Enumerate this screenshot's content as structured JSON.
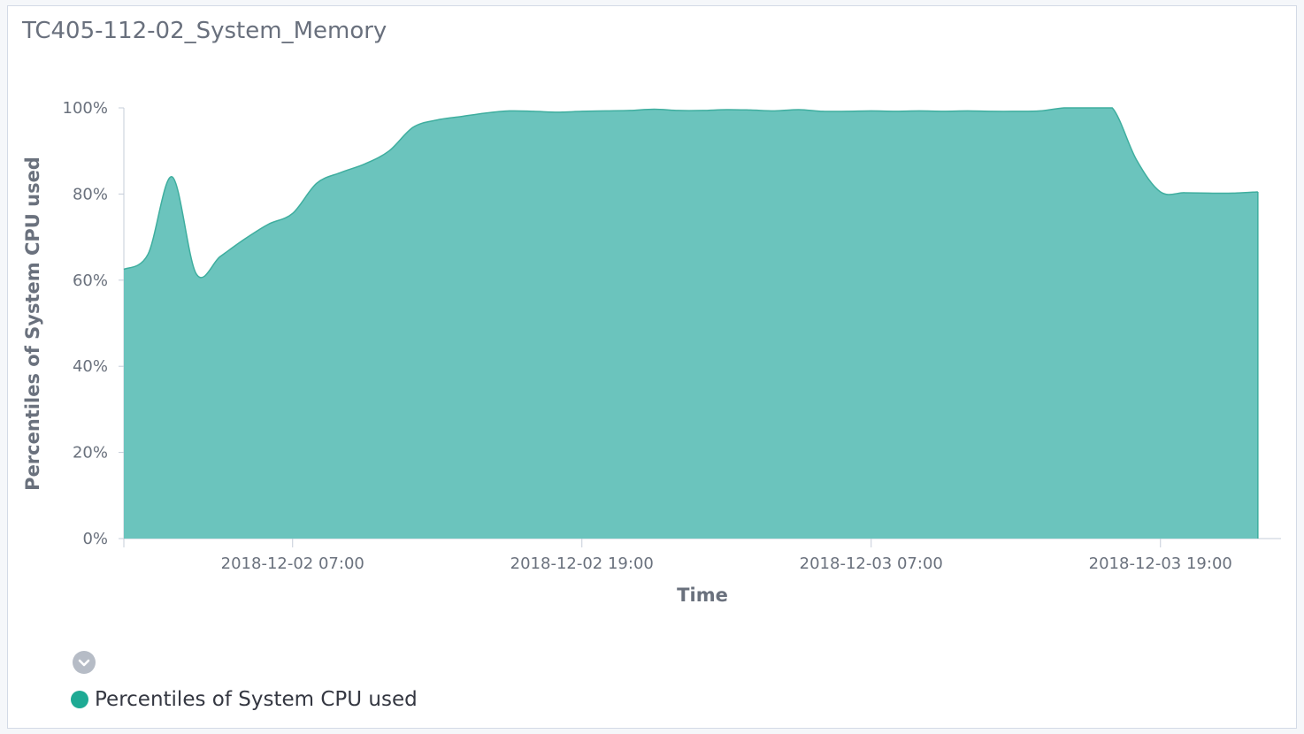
{
  "panel": {
    "title": "TC405-112-02_System_Memory"
  },
  "colors": {
    "series": "#6bc4bd",
    "series_line": "#3fae9f",
    "legend_dot": "#1eaa94",
    "axis": "#c5ccd8"
  },
  "legend": {
    "toggle_icon": "chevron-down-icon",
    "items": [
      {
        "label": "Percentiles of System CPU used"
      }
    ]
  },
  "chart_data": {
    "type": "area",
    "xlabel": "Time",
    "ylabel": "Percentiles of System CPU used",
    "ylim": [
      0,
      100
    ],
    "y_ticks": [
      "0%",
      "20%",
      "40%",
      "60%",
      "80%",
      "100%"
    ],
    "x_ticks": [
      "2018-12-02 07:00",
      "2018-12-02 19:00",
      "2018-12-03 07:00",
      "2018-12-03 19:00"
    ],
    "xlim": [
      "2018-12-02 00:00",
      "2018-12-04 00:00"
    ],
    "grid": false,
    "legend_position": "bottom-left",
    "series": [
      {
        "name": "Percentiles of System CPU used",
        "points": [
          [
            "2018-12-02 00:00",
            62.5
          ],
          [
            "2018-12-02 01:00",
            66
          ],
          [
            "2018-12-02 02:00",
            84
          ],
          [
            "2018-12-02 03:00",
            61.5
          ],
          [
            "2018-12-02 04:00",
            65.5
          ],
          [
            "2018-12-02 05:00",
            69.5
          ],
          [
            "2018-12-02 06:00",
            73
          ],
          [
            "2018-12-02 07:00",
            75.5
          ],
          [
            "2018-12-02 08:00",
            82.5
          ],
          [
            "2018-12-02 09:00",
            85
          ],
          [
            "2018-12-02 10:00",
            87
          ],
          [
            "2018-12-02 11:00",
            90
          ],
          [
            "2018-12-02 12:00",
            95.5
          ],
          [
            "2018-12-02 13:00",
            97.2
          ],
          [
            "2018-12-02 14:00",
            98
          ],
          [
            "2018-12-02 15:00",
            98.8
          ],
          [
            "2018-12-02 16:00",
            99.3
          ],
          [
            "2018-12-02 17:00",
            99.2
          ],
          [
            "2018-12-02 18:00",
            99
          ],
          [
            "2018-12-02 19:00",
            99.2
          ],
          [
            "2018-12-02 20:00",
            99.3
          ],
          [
            "2018-12-02 21:00",
            99.4
          ],
          [
            "2018-12-02 22:00",
            99.7
          ],
          [
            "2018-12-02 23:00",
            99.4
          ],
          [
            "2018-12-03 00:00",
            99.4
          ],
          [
            "2018-12-03 01:00",
            99.6
          ],
          [
            "2018-12-03 02:00",
            99.5
          ],
          [
            "2018-12-03 03:00",
            99.3
          ],
          [
            "2018-12-03 04:00",
            99.6
          ],
          [
            "2018-12-03 05:00",
            99.2
          ],
          [
            "2018-12-03 06:00",
            99.2
          ],
          [
            "2018-12-03 07:00",
            99.3
          ],
          [
            "2018-12-03 08:00",
            99.2
          ],
          [
            "2018-12-03 09:00",
            99.3
          ],
          [
            "2018-12-03 10:00",
            99.2
          ],
          [
            "2018-12-03 11:00",
            99.3
          ],
          [
            "2018-12-03 12:00",
            99.2
          ],
          [
            "2018-12-03 13:00",
            99.2
          ],
          [
            "2018-12-03 14:00",
            99.3
          ],
          [
            "2018-12-03 15:00",
            100
          ],
          [
            "2018-12-03 16:00",
            100
          ],
          [
            "2018-12-03 17:00",
            100
          ],
          [
            "2018-12-03 18:00",
            88
          ],
          [
            "2018-12-03 19:00",
            80.5
          ],
          [
            "2018-12-03 20:00",
            80.3
          ],
          [
            "2018-12-03 21:00",
            80.2
          ],
          [
            "2018-12-03 22:00",
            80.2
          ],
          [
            "2018-12-03 23:00",
            80.5
          ]
        ]
      }
    ]
  }
}
